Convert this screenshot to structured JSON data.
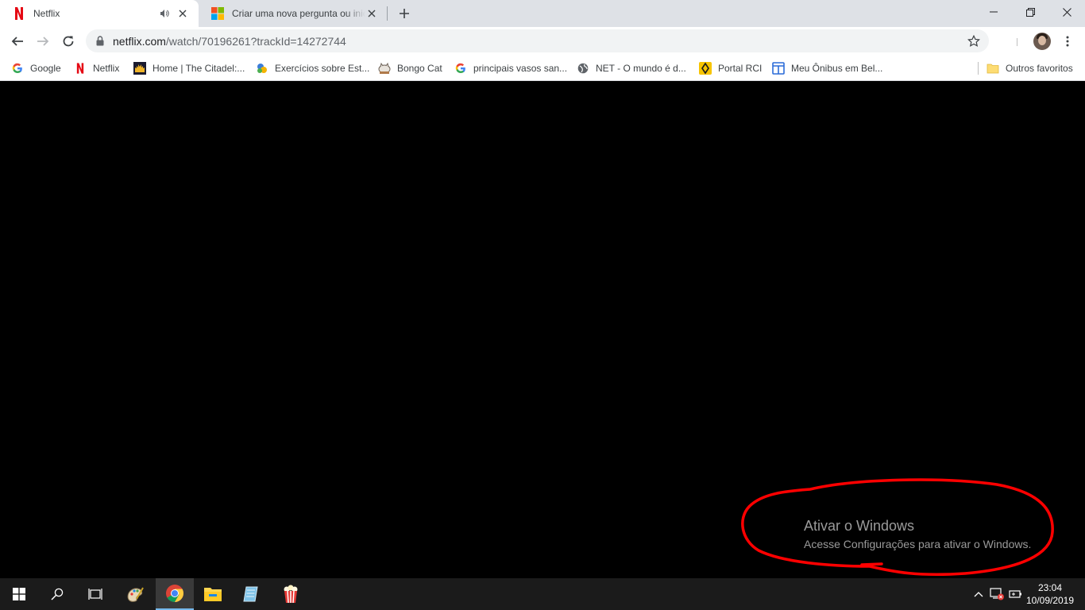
{
  "browser": {
    "tabs": [
      {
        "title": "Netflix",
        "active": true,
        "audio": true
      },
      {
        "title": "Criar uma nova pergunta ou inicie",
        "active": false,
        "audio": false
      }
    ],
    "url": {
      "domain": "netflix.com",
      "path": "/watch/70196261?trackId=14272744"
    }
  },
  "bookmarks": [
    {
      "label": "Google",
      "icon": "google-icon"
    },
    {
      "label": "Netflix",
      "icon": "netflix-icon"
    },
    {
      "label": "Home | The Citadel:...",
      "icon": "citadel-icon"
    },
    {
      "label": "Exercícios sobre Est...",
      "icon": "exercicios-icon"
    },
    {
      "label": "Bongo Cat",
      "icon": "bongo-cat-icon"
    },
    {
      "label": "principais vasos san...",
      "icon": "google-icon"
    },
    {
      "label": "NET - O mundo é d...",
      "icon": "globe-icon"
    },
    {
      "label": "Portal RCI",
      "icon": "renault-icon"
    },
    {
      "label": "Meu Ônibus em Bel...",
      "icon": "bus-icon"
    }
  ],
  "other_bookmarks": "Outros favoritos",
  "activation": {
    "title": "Ativar o Windows",
    "subtitle": "Acesse Configurações para ativar o Windows."
  },
  "taskbar": {
    "time": "23:04",
    "date": "10/09/2019"
  },
  "colors": {
    "netflix_red": "#e50914",
    "annotation_red": "#ff0000",
    "taskbar_accent": "#76b9ed"
  }
}
